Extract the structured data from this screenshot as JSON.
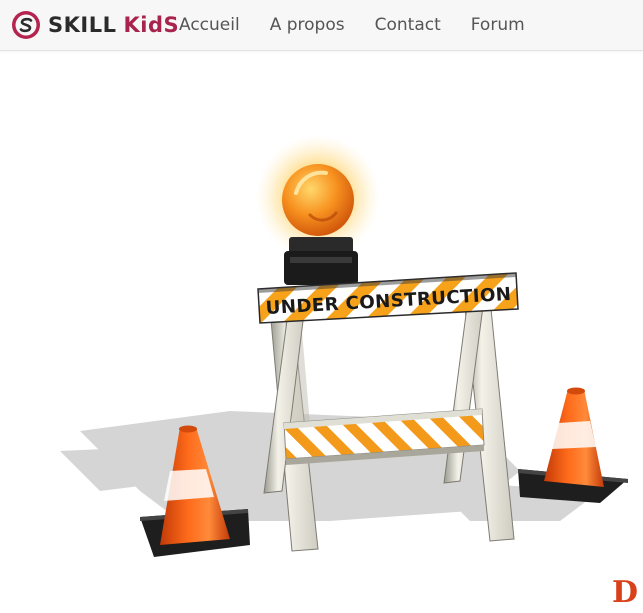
{
  "brand": {
    "word1": "SKILL",
    "word2": "KidS",
    "logo_icon": "circle-s-logo-icon",
    "colors": {
      "logo": "#b5244f",
      "word1": "#2b2b2b",
      "word2": "#a8234e"
    }
  },
  "nav": {
    "items": [
      {
        "label": "Accueil"
      },
      {
        "label": "A propos"
      },
      {
        "label": "Contact"
      },
      {
        "label": "Forum"
      }
    ]
  },
  "hero": {
    "sign_text": "UNDER CONSTRUCTION",
    "partial_heading": "D",
    "icons": [
      "warning-light-icon",
      "barricade-icon",
      "traffic-cone-icon"
    ],
    "colors": {
      "orange": "#f26b1d",
      "stripe": "#f7a21b",
      "heading": "#d8411a"
    }
  }
}
